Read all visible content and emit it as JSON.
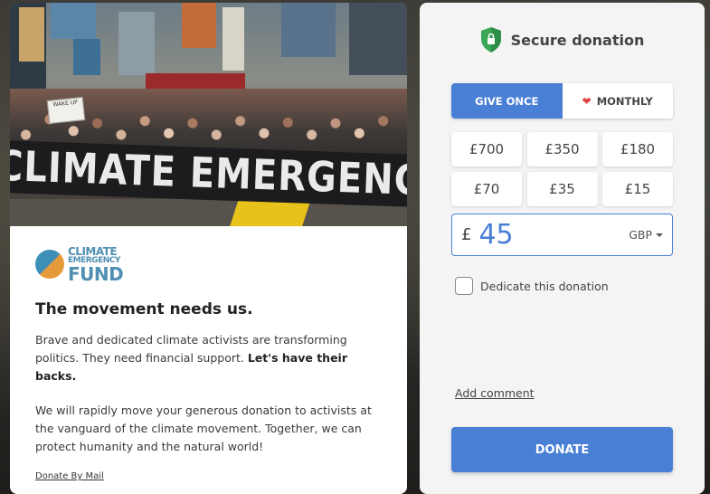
{
  "left": {
    "banner_text": "CLIMATE EMERGENC",
    "sign_text": "WAKE UP",
    "logo": {
      "line1": "CLIMATE",
      "line2": "EMERGENCY",
      "line3": "FUND"
    },
    "headline": "The movement needs us.",
    "para1_text": "Brave and dedicated climate activists are transforming politics. They need financial support.",
    "para1_bold": "Let's have their backs.",
    "para2_text": "We will rapidly move your generous donation to activists at the vanguard of the climate movement. Together, we can protect humanity and the natural world!",
    "mail_link": "Donate By Mail"
  },
  "right": {
    "secure_title": "Secure donation",
    "frequency": {
      "once": "GIVE ONCE",
      "monthly": "MONTHLY",
      "selected": "once"
    },
    "amounts": [
      "£700",
      "£350",
      "£180",
      "£70",
      "£35",
      "£15"
    ],
    "amount_field": {
      "currency_symbol": "£",
      "value": "45",
      "currency": "GBP"
    },
    "dedicate_label": "Dedicate this donation",
    "add_comment": "Add comment",
    "donate_label": "DONATE"
  },
  "colors": {
    "accent": "#4a7fd6",
    "heart": "#e04545",
    "shield": "#3aa757"
  }
}
